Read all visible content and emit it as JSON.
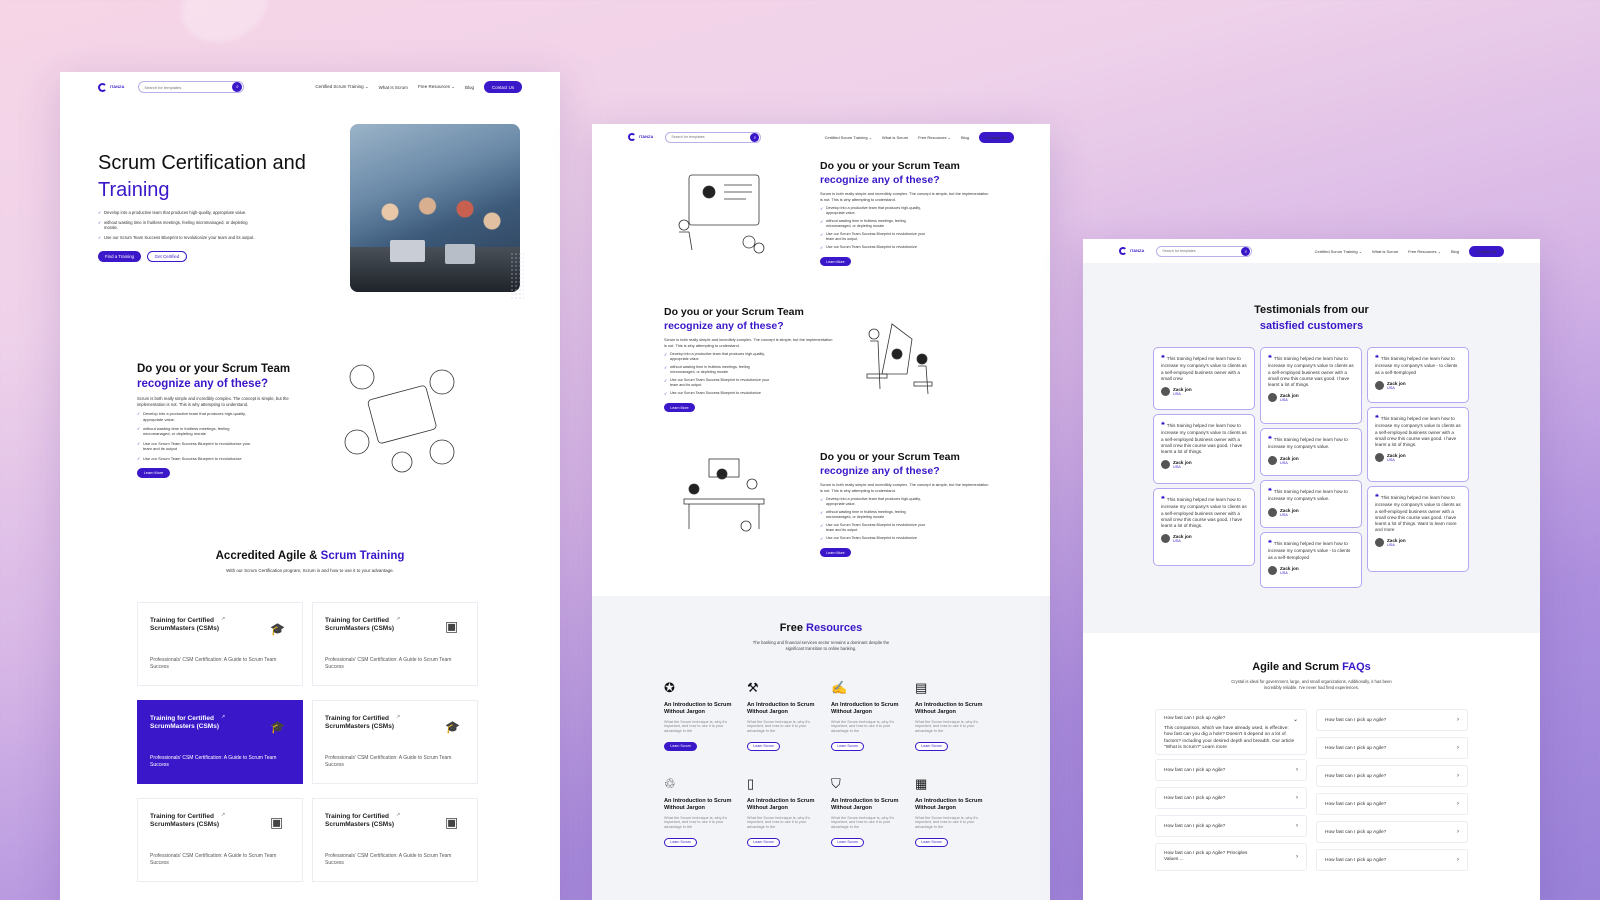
{
  "brand": {
    "logo_text": "ITANZA",
    "accent": "#3a17c9"
  },
  "nav": {
    "search_placeholder": "Search for templates",
    "links": [
      "Certified Scrum Training ⌄",
      "What is Scrum",
      "Free Resources ⌄",
      "Blog"
    ],
    "contact": "Contact Us"
  },
  "hero": {
    "title_line1": "Scrum Certification and",
    "title_line2": "Training",
    "bullets": [
      "Develop into a productive team that produces high-quality, appropriate value.",
      "without wasting time in fruitless meetings, feeling micromanaged, or depleting morale.",
      "Use our Scrum Team Success Blueprint to revolutionize your team and its output."
    ],
    "btn_primary": "Find a Training",
    "btn_secondary": "Get Certified"
  },
  "recognize": {
    "title_line1": "Do you or your Scrum Team",
    "title_line2": "recognize any of these?",
    "desc": "Scrum is both really simple and incredibly complex. The concept is simple, but the implementation is not. This is why attempting to understand.",
    "bullets": [
      "Develop into a productive team that produces high-quality, appropriate value.",
      "without wasting time in fruitless meetings, feeling micromanaged, or depleting morale",
      "Use our Scrum Team Success Blueprint to revolutionize your team and its output",
      "Use our Scrum Team Success Blueprint to revolutionize"
    ],
    "btn": "Learn More"
  },
  "accredited": {
    "title_part1": "Accredited Agile &",
    "title_part2": "Scrum Training",
    "subtitle": "With our Scrum Certification program, Scrum is and how to use it to your advantage.",
    "card_title": "Training for Certified ScrumMasters (CSMs)",
    "card_desc": "Professionals' CSM Certification: A Guide to Scrum Team Success"
  },
  "resources": {
    "title_part1": "Free",
    "title_part2": "Resources",
    "subtitle": "The banking and financial services sector remains a dominant despite the significant transition to online banking.",
    "item_title": "An Introduction to Scrum Without Jargon",
    "item_desc": "What the Scrum technique is, why it's important, and how to use it to your advantage in the",
    "item_btn": "Learn Scrum"
  },
  "testimonials": {
    "title_line1": "Testimonials from our",
    "title_line2": "satisfied customers",
    "quote_long": "This training helped me learn how to increase my company's value to clients as a self-employed business owner with a small crew",
    "quote_longer": "This training helped me learn how to increase my company's value to clients as a self-employed business owner with a small crew this course was good. I have learnt a lot of things.",
    "quote_longest": "This training helped me learn how to increase my company's value to clients as a self-employed business owner with a small crew this course was good. I have learnt a lot of things. Want to learn more and more",
    "quote_short": "This training helped me learn how to increase my company's value.",
    "quote_mid": "This training helped me learn how to increase my company's value - to clients as a self-Itemployed",
    "author": "Zack jon",
    "country": "USA"
  },
  "faqs": {
    "title_part1": "Agile and Scrum",
    "title_part2": "FAQs",
    "subtitle": "Crystal is ideal for government, large, and small organizations. Additionally, it has been incredibly reliable. I've never had fired experiences.",
    "question": "How fast can I pick up Agile?",
    "answer": "This comparison, which we have already used, is effective: how fast can you dig a hole? Doesn't it depend on a lot of factors? including your desired depth and breadth. Our article \"What is Scrum?\"",
    "answer_link": "Learn more",
    "question_alt": "How fast can I pick up Agile? Principles Values ..."
  }
}
